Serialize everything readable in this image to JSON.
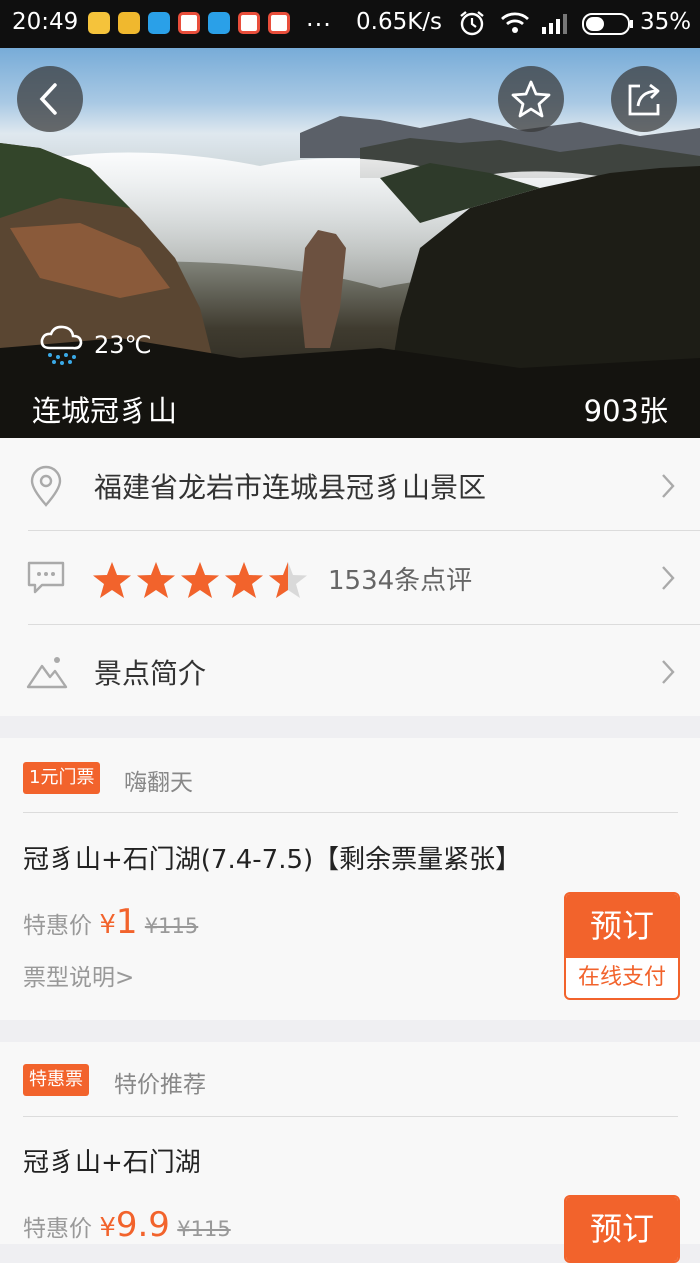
{
  "status_bar": {
    "time": "20:49",
    "more": "...",
    "net_speed": "0.65K/s",
    "battery": "35%"
  },
  "hero": {
    "temperature": "23℃",
    "weather_icon": "rain-cloud-icon",
    "title": "连城冠豸山",
    "photo_count": "903张"
  },
  "info": {
    "address": "福建省龙岩市连城县冠豸山景区",
    "rating_stars": 4.5,
    "reviews": "1534条点评",
    "intro_label": "景点简介"
  },
  "tickets": [
    {
      "tag": "1元门票",
      "seller": "嗨翻天",
      "title": "冠豸山+石门湖(7.4-7.5)【剩余票量紧张】",
      "price_label": "特惠价",
      "currency": "¥",
      "price": "1",
      "original": "¥115",
      "note": "票型说明>",
      "book": "预订",
      "pay": "在线支付"
    },
    {
      "tag": "特惠票",
      "seller": "特价推荐",
      "title": "冠豸山+石门湖",
      "price_label": "特惠价",
      "currency": "¥",
      "price": "9.9",
      "original": "¥115",
      "book": "预订"
    }
  ],
  "colors": {
    "accent": "#f2632c",
    "star": "#f2632c"
  }
}
